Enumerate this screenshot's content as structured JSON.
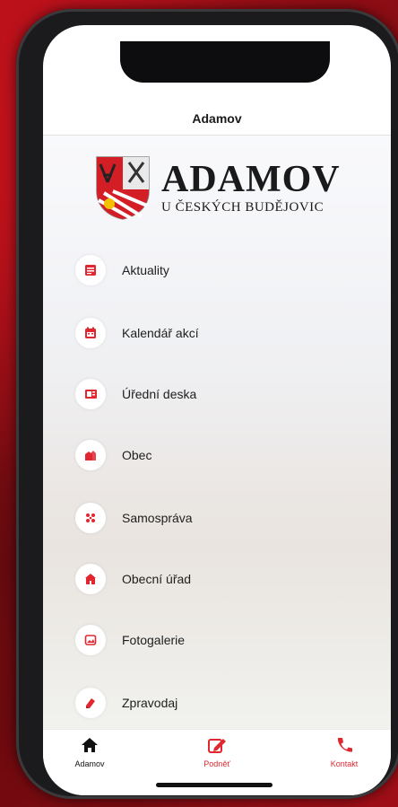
{
  "header": {
    "title": "Adamov"
  },
  "logo": {
    "title": "ADAMOV",
    "subtitle": "U ČESKÝCH BUDĚJOVIC"
  },
  "menu": {
    "items": [
      {
        "label": "Aktuality",
        "icon": "news-icon"
      },
      {
        "label": "Kalendář akcí",
        "icon": "calendar-icon"
      },
      {
        "label": "Úřední deska",
        "icon": "notice-board-icon"
      },
      {
        "label": "Obec",
        "icon": "village-icon"
      },
      {
        "label": "Samospráva",
        "icon": "people-icon"
      },
      {
        "label": "Obecní úřad",
        "icon": "building-icon"
      },
      {
        "label": "Fotogalerie",
        "icon": "photo-icon"
      },
      {
        "label": "Zpravodaj",
        "icon": "newsletter-icon"
      }
    ]
  },
  "tabbar": {
    "tabs": [
      {
        "label": "Adamov",
        "icon": "home-icon"
      },
      {
        "label": "Podněť",
        "icon": "edit-icon"
      },
      {
        "label": "Kontakt",
        "icon": "phone-icon"
      }
    ]
  },
  "colors": {
    "accent": "#e0262e",
    "text": "#1e1e1e",
    "background": "#7a0a10"
  }
}
